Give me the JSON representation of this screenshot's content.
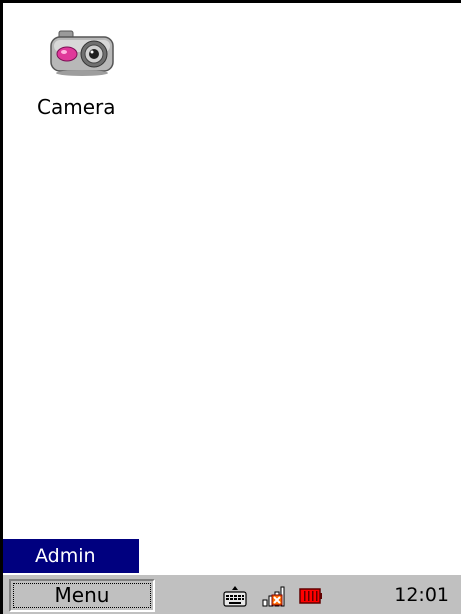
{
  "desktop": {
    "icons": [
      {
        "label": "Camera",
        "icon": "camera-icon"
      }
    ],
    "background_color": "#ffffff"
  },
  "user_badge": {
    "label": "Admin",
    "color": "#00007f"
  },
  "taskbar": {
    "menu_label": "Menu",
    "tray_icons": [
      "keyboard-icon",
      "network-icon",
      "battery-icon"
    ],
    "clock": "12:01",
    "color": "#c0c0c0"
  }
}
